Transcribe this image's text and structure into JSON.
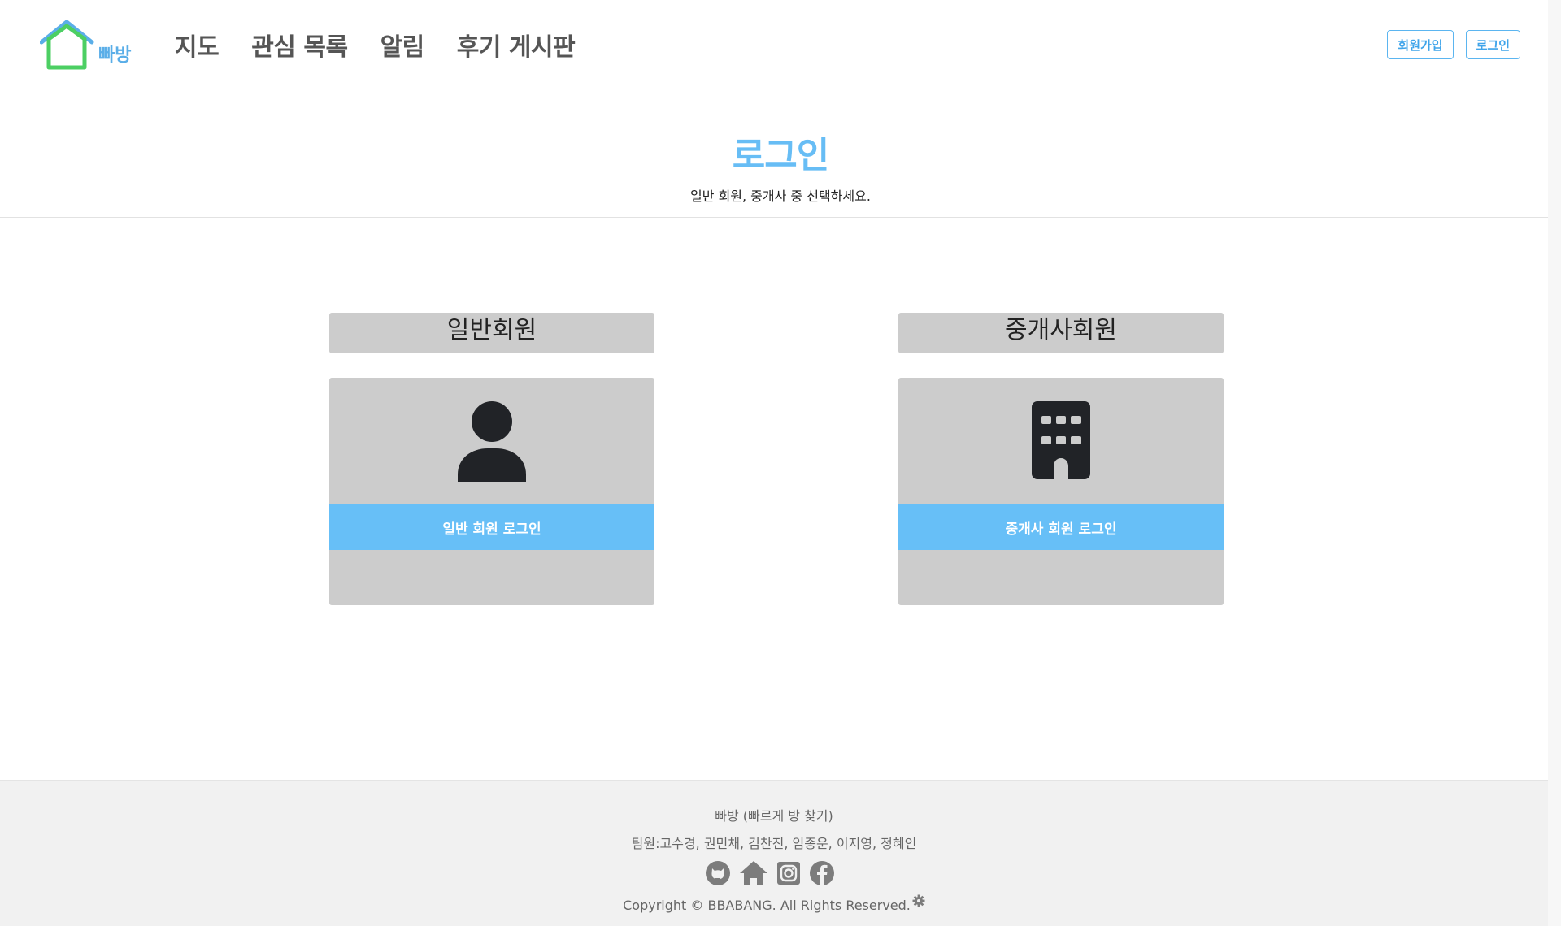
{
  "brand": {
    "logo_text": "빠방"
  },
  "nav": {
    "items": [
      {
        "label": "지도"
      },
      {
        "label": "관심 목록"
      },
      {
        "label": "알림"
      },
      {
        "label": "후기 게시판"
      }
    ]
  },
  "auth": {
    "signup_label": "회원가입",
    "login_label": "로그인"
  },
  "page": {
    "title": "로그인",
    "subtitle": "일반 회원, 중개사 중 선택하세요."
  },
  "cards": {
    "general": {
      "heading": "일반회원",
      "button_label": "일반 회원 로그인",
      "icon": "user-icon"
    },
    "agent": {
      "heading": "중개사회원",
      "button_label": "중개사 회원 로그인",
      "icon": "building-icon"
    }
  },
  "footer": {
    "line1": "빠방 (빠르게 방 찾기)",
    "line2": "팀원:고수경, 권민채, 김찬진, 임종운, 이지영, 정혜인",
    "social_icons": [
      "github-icon",
      "home-icon",
      "instagram-icon",
      "facebook-icon"
    ],
    "copyright": "Copyright © BBABANG. All Rights Reserved."
  },
  "colors": {
    "accent": "#67bff7",
    "title": "#67bdf5",
    "logo_roof": "#5aaee8",
    "logo_house": "#4ccf63",
    "card_bg": "#cccccc",
    "footer_bg": "#f1f1f1"
  }
}
